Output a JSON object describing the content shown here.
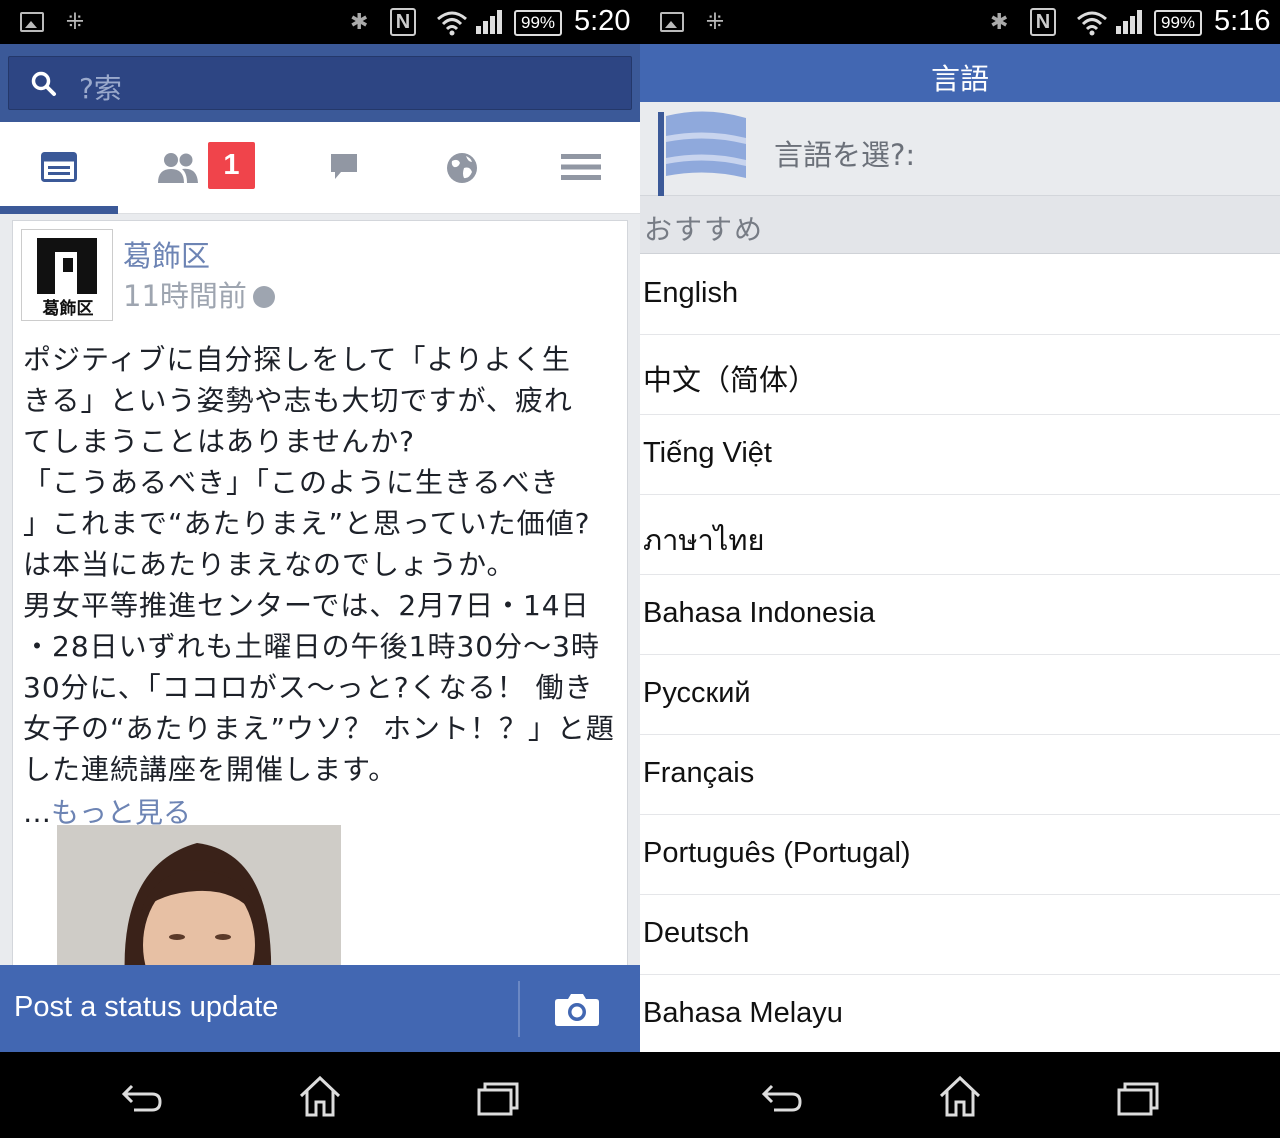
{
  "left": {
    "status": {
      "battery": "99%",
      "time": "5:20"
    },
    "search": {
      "placeholder": "?索"
    },
    "tabs": {
      "friend_requests_badge": "1"
    },
    "post": {
      "author": "葛飾区",
      "avatar_label": "葛飾区",
      "time": "11時間前",
      "body": "ポジティブに自分探しをして「よりよく生\nきる」という姿勢や志も大切ですが、疲れ\nてしまうことはありませんか?\n「こうあるべき」「このように生きるべき\n」これまで“あたりまえ”と思っていた価値?\nは本当にあたりまえなのでしょうか。\n男女平等推進センターでは、2月7日・14日\n・28日いずれも土曜日の午後1時30分～3時\n30分に、「ココロがス～っと?くなる！ 働き\n女子の“あたりまえ”ウソ？ ホント！？」と題\nした連続講座を開催します。",
      "ellipsis": "…",
      "see_more": "もっと見る"
    },
    "composer": {
      "label": "Post a status update"
    }
  },
  "right": {
    "status": {
      "battery": "99%",
      "time": "5:16"
    },
    "header": {
      "title": "言語"
    },
    "choose_prompt": "言語を選?:",
    "section_title": "おすすめ",
    "languages": [
      "English",
      "中文（简体）",
      "Tiếng Việt",
      "ภาษาไทย",
      "Bahasa Indonesia",
      "Русский",
      "Français",
      "Português (Portugal)",
      "Deutsch",
      "Bahasa Melayu"
    ]
  },
  "colors": {
    "facebook_blue": "#3b5998",
    "composer_blue": "#4267b2",
    "badge_red": "#f0444b",
    "link_blue": "#6d84b4"
  }
}
